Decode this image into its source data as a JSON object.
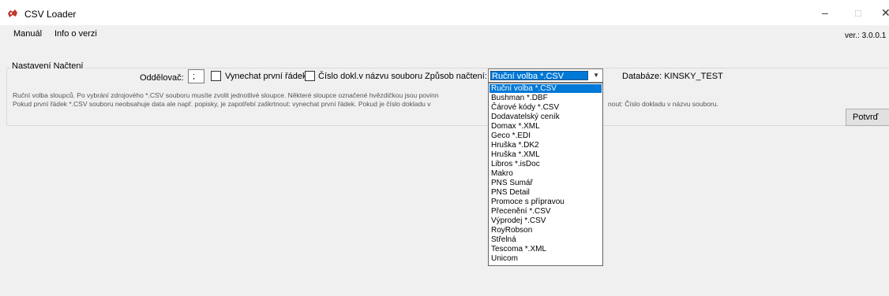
{
  "window": {
    "title": "CSV Loader",
    "minimize_glyph": "–",
    "maximize_glyph": "☐",
    "close_glyph": "✕"
  },
  "menu": {
    "manual": "Manuál",
    "info": "Info o verzi"
  },
  "version": "ver.: 3.0.0.1",
  "settings": {
    "group_label": "Nastavení Načtení",
    "separator_label": "Oddělovač:",
    "separator_value": ";",
    "skip_first_row_label": "Vynechat první řádek",
    "skip_first_row_checked": false,
    "doc_number_label": "Číslo dokl.v názvu souboru",
    "doc_number_checked": false,
    "load_mode_label": "Způsob načtení:",
    "load_mode_value": "Ruční volba *.CSV",
    "database": "Databáze: KINSKY_TEST"
  },
  "info": {
    "line1": "Ruční volba sloupců. Po vybrání zdrojového *.CSV souboru musíte zvolit jednotlivé sloupce. Některé sloupce označené hvězdičkou jsou povinn",
    "line2": "Pokud první řádek *.CSV souboru neobsahuje data ale např. popisky, je zapotřebí zaškrtnout: vynechat první řádek. Pokud je číslo dokladu v",
    "line3": "nout: Číslo dokladu v názvu souboru."
  },
  "confirm_button": "Potvrď",
  "dropdown": {
    "selected_index": 0,
    "options": [
      "Ruční volba *.CSV",
      "Bushman *.DBF",
      "Čárové kódy *.CSV",
      "Dodavatelský ceník",
      "Domax *.XML",
      "Geco *.EDI",
      "Hruška *.DK2",
      "Hruška *.XML",
      "Libros *.isDoc",
      "Makro",
      "PNS Sumář",
      "PNS Detail",
      "Promoce s přípravou",
      "Přecenění *.CSV",
      "Výprodej *.CSV",
      "RoyRobson",
      "Střelná",
      "Tescoma *.XML",
      "Unicom"
    ]
  },
  "colors": {
    "selection": "#0078d7",
    "window_bg": "#f0f0f0",
    "titlebar_bg": "#ffffff"
  }
}
